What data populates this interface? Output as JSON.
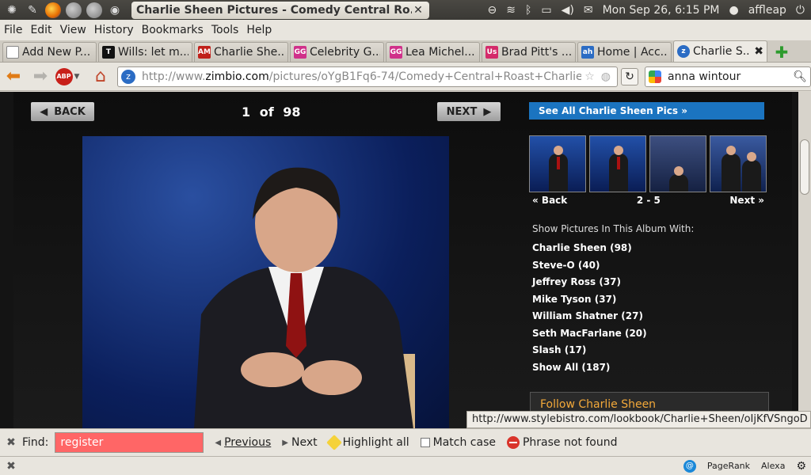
{
  "system": {
    "window_title": "Charlie Sheen Pictures - Comedy Central Ro...",
    "datetime": "Mon Sep 26,  6:15 PM",
    "user": "affleap"
  },
  "menu": [
    "File",
    "Edit",
    "View",
    "History",
    "Bookmarks",
    "Tools",
    "Help"
  ],
  "tabs": [
    {
      "label": "Add New P...",
      "fav": "",
      "color": "#d8d4cc"
    },
    {
      "label": "Wills: let m...",
      "fav": "T",
      "color": "#111111"
    },
    {
      "label": "Charlie She...",
      "fav": "AM",
      "color": "#c0201a"
    },
    {
      "label": "Celebrity G...",
      "fav": "GG",
      "color": "#d0308a"
    },
    {
      "label": "Lea Michel...",
      "fav": "GG",
      "color": "#d0308a"
    },
    {
      "label": "Brad Pitt's ...",
      "fav": "Us",
      "color": "#d42a6a"
    },
    {
      "label": "Home | Acc...",
      "fav": "ah",
      "color": "#2b6cc4"
    },
    {
      "label": "Charlie S...",
      "fav": "z",
      "color": "#2b6cc4",
      "active": true
    }
  ],
  "nav": {
    "url_host": "http://www.",
    "url_domain": "zimbio.com",
    "url_path": "/pictures/oYgB1Fq6-74/Comedy+Central+Roast+Charlie+",
    "search_value": "anna wintour"
  },
  "page": {
    "back_label": "BACK",
    "next_label": "NEXT",
    "pager_current": "1",
    "pager_of": "of",
    "pager_total": "98",
    "see_all": "See All Charlie Sheen Pics »",
    "thumb_back": "« Back",
    "thumb_range": "2 - 5",
    "thumb_next": "Next »",
    "album_title": "Show Pictures In This Album With:",
    "album_items": [
      "Charlie Sheen (98)",
      "Steve-O (40)",
      "Jeffrey Ross (37)",
      "Mike Tyson (37)",
      "William Shatner (27)",
      "Seth MacFarlane (20)",
      "Slash (17)",
      "Show All (187)"
    ],
    "follow": "Follow Charlie Sheen"
  },
  "status_link": "http://www.stylebistro.com/lookbook/Charlie+Sheen/oIjKfVSngoD",
  "find": {
    "label": "Find:",
    "value": "register",
    "previous": "Previous",
    "next": "Next",
    "highlight": "Highlight all",
    "match_case": "Match case",
    "status": "Phrase not found"
  },
  "addons": {
    "pagerank": "PageRank",
    "alexa": "Alexa"
  }
}
